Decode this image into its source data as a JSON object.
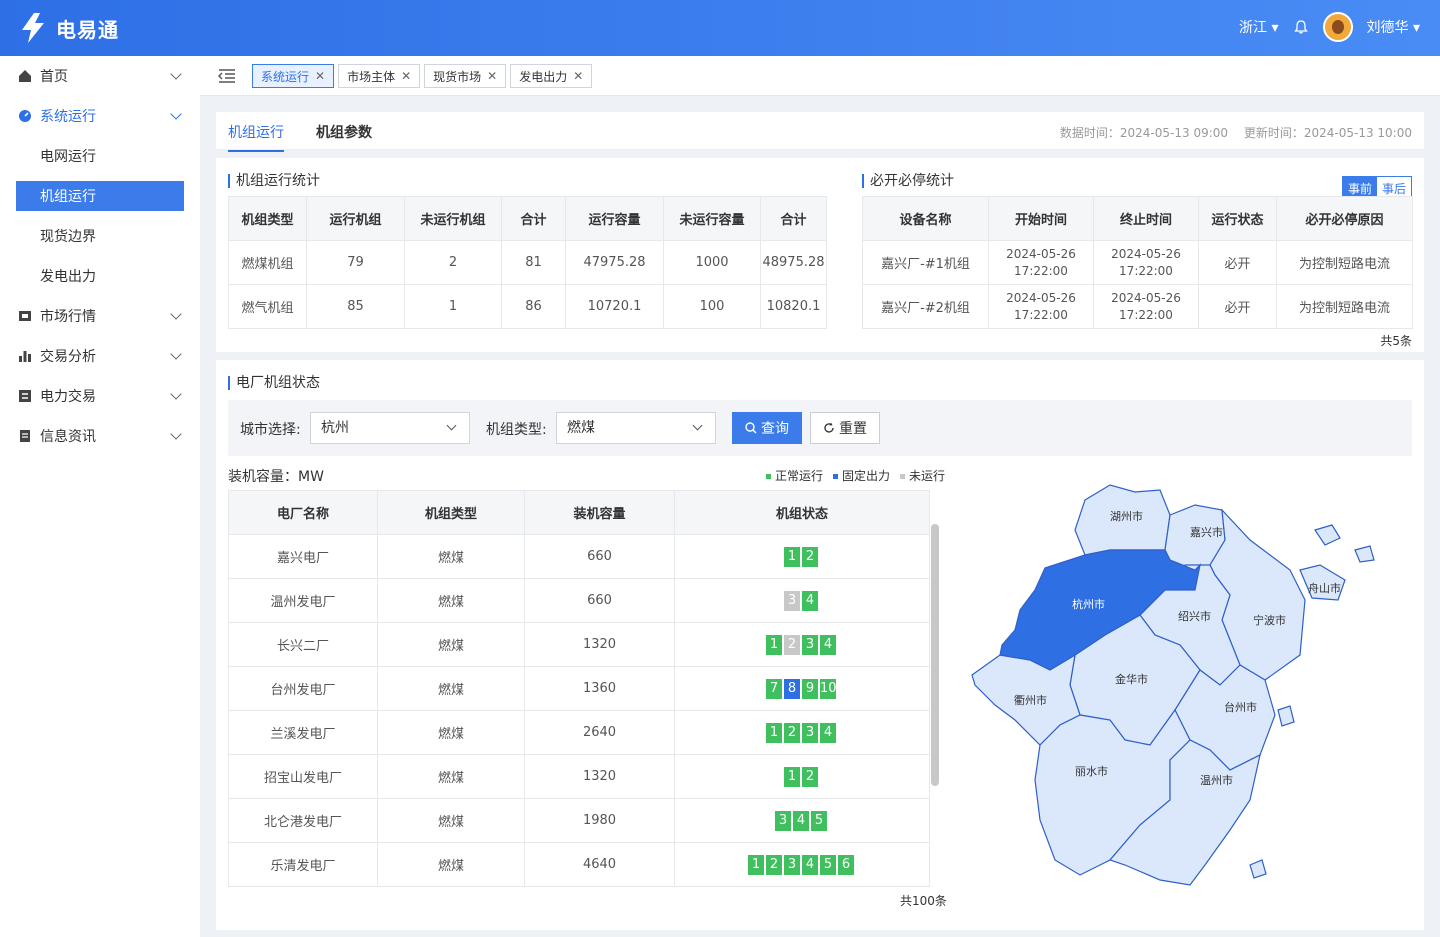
{
  "app": {
    "name": "电易通"
  },
  "top": {
    "region": "浙江",
    "user": "刘德华"
  },
  "menu": {
    "home": "首页",
    "sysrun": "系统运行",
    "grid": "电网运行",
    "unitrun": "机组运行",
    "spot": "现货边界",
    "gen": "发电出力",
    "market": "市场行情",
    "trade_analysis": "交易分析",
    "power_trade": "电力交易",
    "info": "信息资讯"
  },
  "tags": [
    {
      "label": "系统运行"
    },
    {
      "label": "市场主体"
    },
    {
      "label": "现货市场"
    },
    {
      "label": "发电出力"
    }
  ],
  "tabs": {
    "t1": "机组运行",
    "t2": "机组参数"
  },
  "times": {
    "data": "数据时间：2024-05-13 09:00",
    "update": "更新时间：2024-05-13 10:00"
  },
  "unit_stats": {
    "title": "机组运行统计",
    "headers": [
      "机组类型",
      "运行机组",
      "未运行机组",
      "合计",
      "运行容量",
      "未运行容量",
      "合计"
    ],
    "rows": [
      [
        "燃煤机组",
        "79",
        "2",
        "81",
        "47975.28",
        "1000",
        "48975.28"
      ],
      [
        "燃气机组",
        "85",
        "1",
        "86",
        "10720.1",
        "100",
        "10820.1"
      ]
    ]
  },
  "must": {
    "title": "必开必停统计",
    "toggle_on": "事前",
    "toggle_off": "事后",
    "headers": [
      "设备名称",
      "开始时间",
      "终止时间",
      "运行状态",
      "必开必停原因"
    ],
    "rows": [
      [
        "嘉兴厂-#1机组",
        "2024-05-26",
        "17:22:00",
        "2024-05-26",
        "17:22:00",
        "必开",
        "为控制短路电流"
      ],
      [
        "嘉兴厂-#2机组",
        "2024-05-26",
        "17:22:00",
        "2024-05-26",
        "17:22:00",
        "必开",
        "为控制短路电流"
      ]
    ],
    "count": "共5条"
  },
  "plant": {
    "title": "电厂机组状态",
    "city_label": "城市选择:",
    "city": "杭州",
    "type_label": "机组类型:",
    "type": "燃煤",
    "query": "查询",
    "reset": "重置",
    "unit": "装机容量：MW",
    "legend": [
      "正常运行",
      "固定出力",
      "未运行"
    ],
    "legend_colors": [
      "#3fbf5e",
      "#2f6fe4",
      "#c8c8c8"
    ],
    "headers": [
      "电厂名称",
      "机组类型",
      "装机容量",
      "机组状态"
    ],
    "rows": [
      {
        "name": "嘉兴电厂",
        "type": "燃煤",
        "cap": "660",
        "units": [
          [
            "1",
            "g"
          ],
          [
            "2",
            "g"
          ]
        ]
      },
      {
        "name": "温州发电厂",
        "type": "燃煤",
        "cap": "660",
        "units": [
          [
            "3",
            "y"
          ],
          [
            "4",
            "g"
          ]
        ]
      },
      {
        "name": "长兴二厂",
        "type": "燃煤",
        "cap": "1320",
        "units": [
          [
            "1",
            "g"
          ],
          [
            "2",
            "y"
          ],
          [
            "3",
            "g"
          ],
          [
            "4",
            "g"
          ]
        ]
      },
      {
        "name": "台州发电厂",
        "type": "燃煤",
        "cap": "1360",
        "units": [
          [
            "7",
            "g"
          ],
          [
            "8",
            "b"
          ],
          [
            "9",
            "g"
          ],
          [
            "10",
            "g"
          ]
        ]
      },
      {
        "name": "兰溪发电厂",
        "type": "燃煤",
        "cap": "2640",
        "units": [
          [
            "1",
            "g"
          ],
          [
            "2",
            "g"
          ],
          [
            "3",
            "g"
          ],
          [
            "4",
            "g"
          ]
        ]
      },
      {
        "name": "招宝山发电厂",
        "type": "燃煤",
        "cap": "1320",
        "units": [
          [
            "1",
            "g"
          ],
          [
            "2",
            "g"
          ]
        ]
      },
      {
        "name": "北仑港发电厂",
        "type": "燃煤",
        "cap": "1980",
        "units": [
          [
            "3",
            "g"
          ],
          [
            "4",
            "g"
          ],
          [
            "5",
            "g"
          ]
        ]
      },
      {
        "name": "乐清发电厂",
        "type": "燃煤",
        "cap": "4640",
        "units": [
          [
            "1",
            "g"
          ],
          [
            "2",
            "g"
          ],
          [
            "3",
            "g"
          ],
          [
            "4",
            "g"
          ],
          [
            "5",
            "g"
          ],
          [
            "6",
            "g"
          ]
        ]
      }
    ],
    "count": "共100条"
  },
  "map": {
    "cities": [
      "湖州市",
      "嘉兴市",
      "舟山市",
      "杭州市",
      "绍兴市",
      "宁波市",
      "金华市",
      "衢州市",
      "台州市",
      "丽水市",
      "温州市"
    ],
    "selected": "杭州市"
  }
}
